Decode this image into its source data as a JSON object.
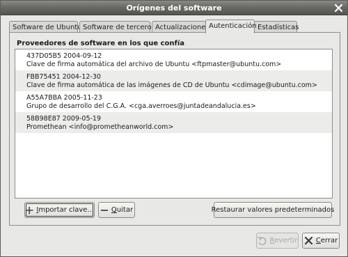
{
  "window": {
    "title": "Orígenes del software"
  },
  "tabs": [
    {
      "label": "Software de Ubuntu"
    },
    {
      "label": "Software de terceros"
    },
    {
      "label": "Actualizaciones"
    },
    {
      "label": "Autenticación"
    },
    {
      "label": "Estadísticas"
    }
  ],
  "active_tab": "Autenticación",
  "section": {
    "title": "Proveedores de software en los que confía"
  },
  "keys": [
    {
      "id_line": "437D05B5 2004-09-12",
      "desc": "Clave de firma automática del archivo de Ubuntu <ftpmaster@ubuntu.com>"
    },
    {
      "id_line": "FBB75451 2004-12-30",
      "desc": "Clave de firma automática de las imágenes de CD de Ubuntu <cdimage@ubuntu.com>"
    },
    {
      "id_line": "A55A7BBA 2005-11-23",
      "desc": "Grupo de desarrollo del C.G.A. <cga.averroes@juntadeandalucia.es>"
    },
    {
      "id_line": "58B98E87 2009-05-19",
      "desc": "Promethean <info@prometheanworld.com>"
    }
  ],
  "buttons": {
    "import_prefix": "I",
    "import_rest": "mportar clave...",
    "remove_prefix": "Q",
    "remove_rest": "uitar",
    "restore": "Restaurar valores predeterminados",
    "revert_prefix": "R",
    "revert_rest": "evertir",
    "close_prefix": "C",
    "close_rest": "errar"
  }
}
